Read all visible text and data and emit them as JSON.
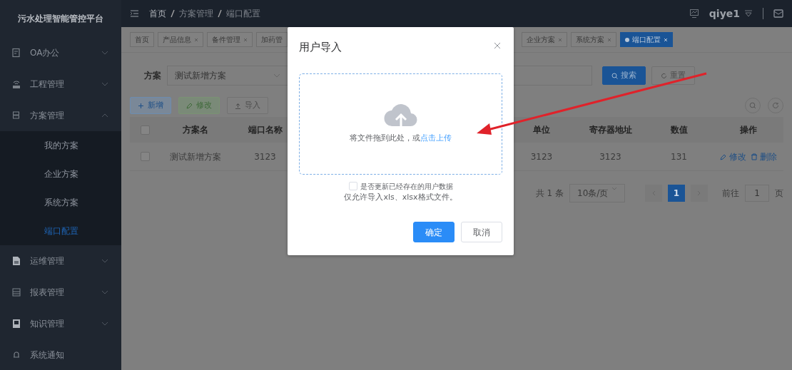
{
  "app_title": "污水处理智能管控平台",
  "sidebar": {
    "items": [
      {
        "label": "OA办公",
        "kind": "group",
        "expanded": false
      },
      {
        "label": "工程管理",
        "kind": "group",
        "expanded": false
      },
      {
        "label": "方案管理",
        "kind": "group",
        "expanded": true,
        "children": [
          {
            "label": "我的方案",
            "selected": false
          },
          {
            "label": "企业方案",
            "selected": false
          },
          {
            "label": "系统方案",
            "selected": false
          },
          {
            "label": "端口配置",
            "selected": true
          }
        ]
      },
      {
        "label": "运维管理",
        "kind": "group",
        "expanded": false
      },
      {
        "label": "报表管理",
        "kind": "group",
        "expanded": false
      },
      {
        "label": "知识管理",
        "kind": "group",
        "expanded": false
      },
      {
        "label": "系统通知",
        "kind": "link"
      }
    ]
  },
  "header": {
    "breadcrumb": [
      "首页",
      "方案管理",
      "端口配置"
    ],
    "user": "qiye1"
  },
  "tags": [
    {
      "label": "首页",
      "closable": false,
      "selected": false
    },
    {
      "label": "产品信息",
      "closable": true,
      "selected": false
    },
    {
      "label": "备件管理",
      "closable": true,
      "selected": false
    },
    {
      "label": "加药管",
      "closable": false,
      "selected": false
    },
    {
      "label": "企业方案",
      "closable": true,
      "selected": false
    },
    {
      "label": "系统方案",
      "closable": true,
      "selected": false
    },
    {
      "label": "端口配置",
      "closable": true,
      "selected": true
    }
  ],
  "filter": {
    "label": "方案",
    "value": "测试新增方案",
    "search_button": "搜索",
    "reset_button": "重置"
  },
  "toolbar": [
    {
      "label": "新增",
      "kind": "add"
    },
    {
      "label": "修改",
      "kind": "edit"
    },
    {
      "label": "导入",
      "kind": "import"
    }
  ],
  "table": {
    "all_checked": false,
    "columns": [
      "方案名",
      "端口名称",
      "单位",
      "寄存器地址",
      "数值",
      "操作"
    ],
    "rows": [
      {
        "checked": false,
        "cells": [
          "测试新增方案",
          "3123",
          "3123",
          "3123",
          "131"
        ],
        "actions": [
          "修改",
          "删除"
        ]
      }
    ]
  },
  "pagination": {
    "total": "共 1 条",
    "page_size": "10条/页",
    "pages": [
      {
        "label": "1",
        "selected": true
      }
    ],
    "goto_label": "前往",
    "goto_value": "1",
    "goto_suffix": "页"
  },
  "modal": {
    "title": "用户导入",
    "upload_text": "将文件拖到此处，或",
    "upload_link": "点击上传",
    "update_checkbox": {
      "label": "是否更新已经存在的用户数据",
      "checked": false
    },
    "tip": "仅允许导入xls、xlsx格式文件。",
    "buttons": [
      {
        "label": "确定",
        "kind": "primary"
      },
      {
        "label": "取消",
        "kind": "default"
      }
    ]
  }
}
